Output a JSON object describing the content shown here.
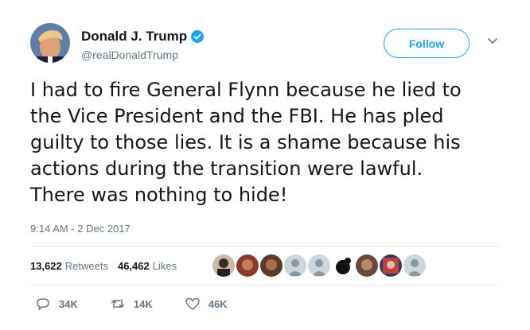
{
  "author": {
    "name": "Donald J. Trump",
    "handle": "@realDonaldTrump",
    "verified": true
  },
  "follow_button": {
    "label": "Follow",
    "color": "#1da1f2"
  },
  "menu_icon": "chevron-down-icon",
  "tweet": {
    "lines": [
      "I had to fire General Flynn because he lied to",
      "the Vice President and the FBI. He has pled",
      "guilty to those lies. It is a shame because his",
      "actions during the transition were lawful.",
      "There was nothing to hide!"
    ],
    "timestamp": "9:14 AM - 2 Dec 2017"
  },
  "stats": {
    "retweets": {
      "count": "13,622",
      "label": "Retweets"
    },
    "likes": {
      "count": "46,462",
      "label": "Likes"
    }
  },
  "likers_count_shown": 9,
  "actions": {
    "replies": "34K",
    "retweets": "14K",
    "likes": "46K"
  },
  "colors": {
    "accent": "#1da1f2",
    "secondary_text": "#657786",
    "divider": "#e6ecf0"
  }
}
